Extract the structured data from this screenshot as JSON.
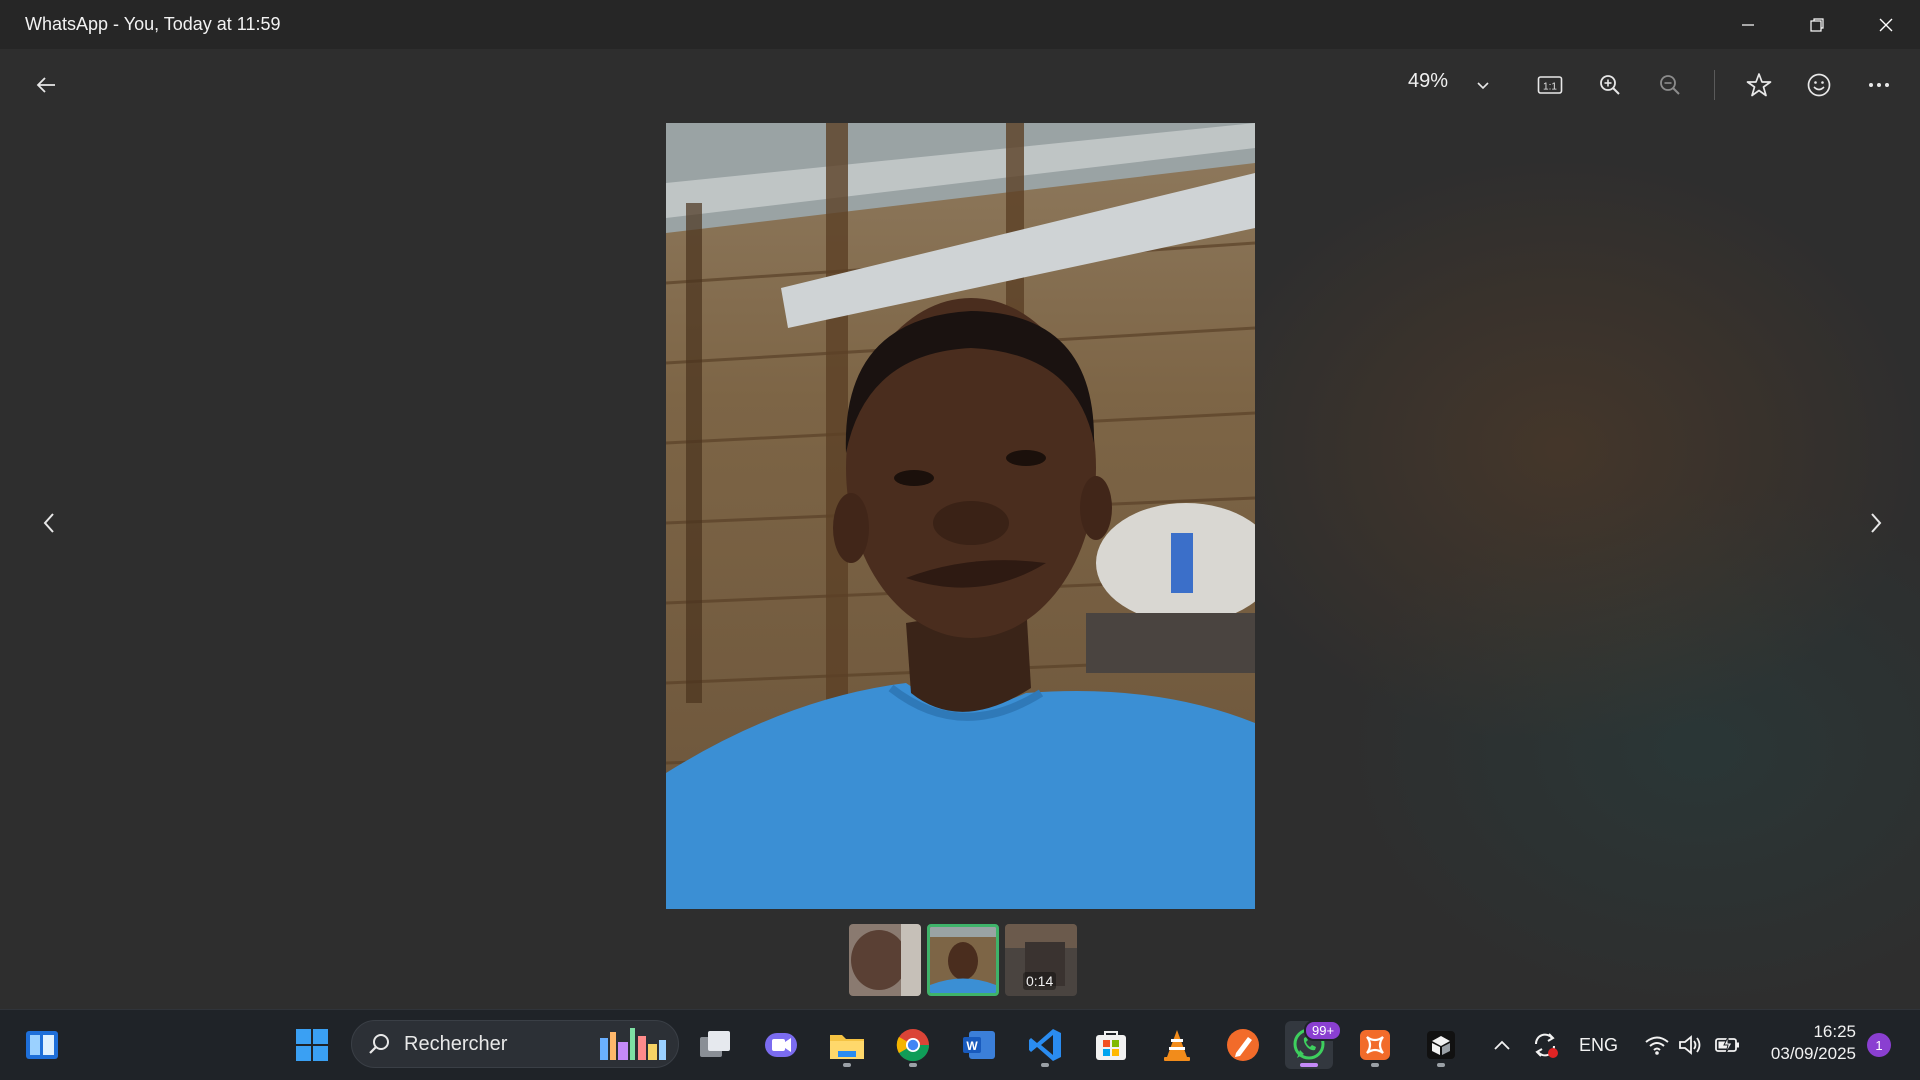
{
  "window": {
    "title": "WhatsApp - You, Today at 11:59",
    "controls": [
      "minimize-icon",
      "restore-icon",
      "close-icon"
    ]
  },
  "toolbar": {
    "back_icon": "arrow-left-icon",
    "zoom_value": "49%",
    "icons": [
      "chevron-down-icon",
      "actual-size-icon",
      "zoom-in-icon",
      "zoom-out-icon",
      "star-icon",
      "emoji-icon",
      "more-icon"
    ],
    "actual_size_label": "1:1"
  },
  "navigation": {
    "prev_icon": "chevron-left-icon",
    "next_icon": "chevron-right-icon"
  },
  "filmstrip": [
    {
      "kind": "photo",
      "active": false
    },
    {
      "kind": "photo",
      "active": true
    },
    {
      "kind": "video",
      "active": false,
      "duration": "0:14"
    }
  ],
  "taskbar": {
    "search_placeholder": "Rechercher",
    "apps": [
      "widgets-icon",
      "start-icon",
      "task-view-icon",
      "teams-icon",
      "file-explorer-icon",
      "chrome-icon",
      "word-icon",
      "vscode-icon",
      "store-icon",
      "vlc-icon",
      "app-orange-icon",
      "whatsapp-icon",
      "xampp-icon",
      "app-dark-icon"
    ],
    "whatsapp_badge": "99+",
    "tray": {
      "language": "ENG",
      "time": "16:25",
      "date": "03/09/2025",
      "notification_count": "1"
    }
  },
  "colors": {
    "background": "#2e2e2e",
    "titlebar": "#262626",
    "taskbar": "#1f2328",
    "accent_green": "#3fb36a",
    "badge_purple": "#8a3fd1"
  }
}
